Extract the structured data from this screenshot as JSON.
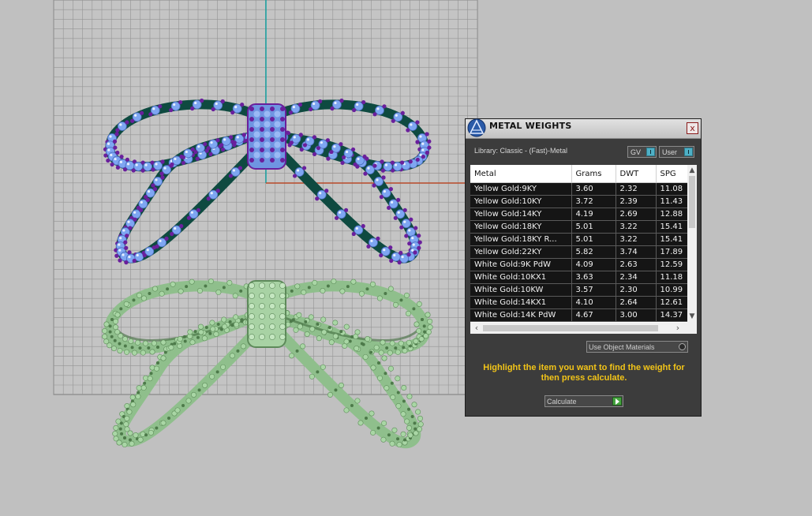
{
  "panel": {
    "title": "METAL WEIGHTS",
    "close_label": "x",
    "library_label": "Library: Classic - (Fast)-Metal",
    "toggles": {
      "gv": "GV",
      "user": "User"
    },
    "columns": [
      "Metal",
      "Grams",
      "DWT",
      "SPG"
    ],
    "rows": [
      [
        "Yellow Gold:9KY",
        "3.60",
        "2.32",
        "11.08"
      ],
      [
        "Yellow Gold:10KY",
        "3.72",
        "2.39",
        "11.43"
      ],
      [
        "Yellow Gold:14KY",
        "4.19",
        "2.69",
        "12.88"
      ],
      [
        "Yellow Gold:18KY",
        "5.01",
        "3.22",
        "15.41"
      ],
      [
        "Yellow Gold:18KY R...",
        "5.01",
        "3.22",
        "15.41"
      ],
      [
        "Yellow Gold:22KY",
        "5.82",
        "3.74",
        "17.89"
      ],
      [
        "White Gold:9K PdW",
        "4.09",
        "2.63",
        "12.59"
      ],
      [
        "White Gold:10KX1",
        "3.63",
        "2.34",
        "11.18"
      ],
      [
        "White Gold:10KW",
        "3.57",
        "2.30",
        "10.99"
      ],
      [
        "White Gold:14KX1",
        "4.10",
        "2.64",
        "12.61"
      ],
      [
        "White Gold:14K PdW",
        "4.67",
        "3.00",
        "14.37"
      ]
    ],
    "use_object_materials_label": "Use Object Materials",
    "use_object_materials_checked": false,
    "instructions": "Highlight the item you want to find the weight for then press calculate.",
    "calculate_label": "Calculate"
  },
  "colors": {
    "viewport_bg": "#c0c0c0",
    "grid_line": "#8f8f8f",
    "axis_y": "#17a3a3",
    "axis_x": "#b84a2a",
    "upper_band": "#0e4a40",
    "upper_gems": "#7ea6f2",
    "upper_prongs": "#6a1f9c",
    "lower_band": "#8fbf8c",
    "instructions_text": "#f2c418"
  }
}
